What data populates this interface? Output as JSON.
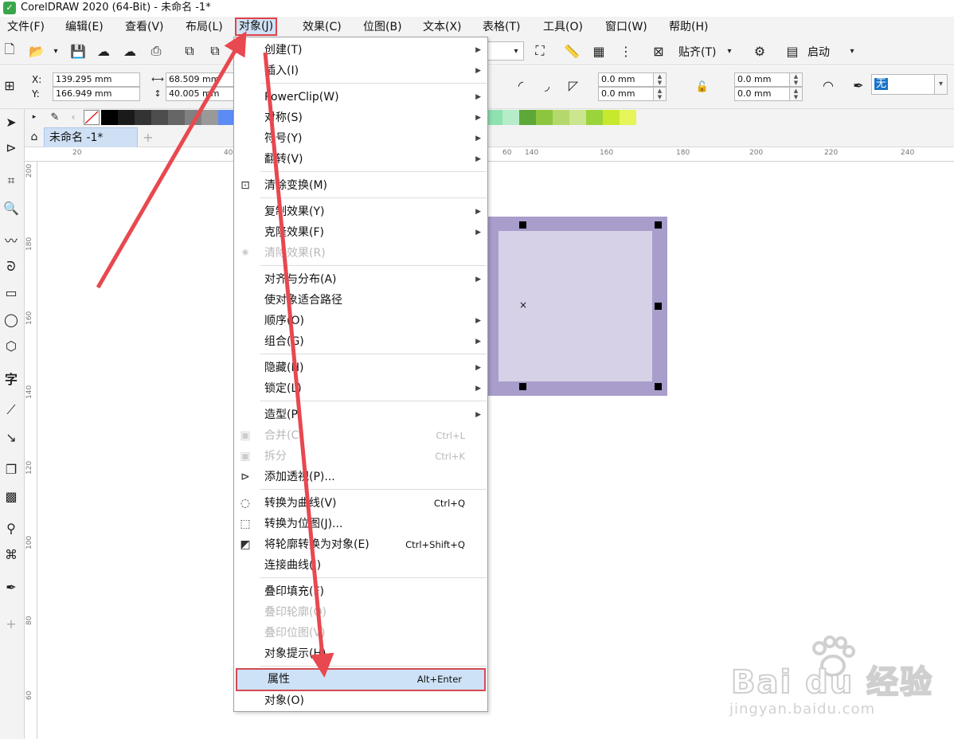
{
  "title": "CorelDRAW 2020 (64-Bit) - 未命名 -1*",
  "menubar": [
    "文件(F)",
    "编辑(E)",
    "查看(V)",
    "布局(L)",
    "对象(J)",
    "效果(C)",
    "位图(B)",
    "文本(X)",
    "表格(T)",
    "工具(O)",
    "窗口(W)",
    "帮助(H)"
  ],
  "toolbar": {
    "snap_label": "贴齐(T)",
    "launch_label": "启动"
  },
  "propbar": {
    "x_label": "X:",
    "x_value": "139.295 mm",
    "y_label": "Y:",
    "y_value": "166.949 mm",
    "w_value": "68.509 mm",
    "h_value": "40.005 mm",
    "corner1": "0.0 mm",
    "corner2": "0.0 mm",
    "corner3": "0.0 mm",
    "corner4": "0.0 mm",
    "outline_value": "无"
  },
  "doc_tab": "未命名 -1*",
  "ruler_h": [
    "20",
    "40",
    "60",
    "140",
    "160",
    "180",
    "200",
    "220",
    "240"
  ],
  "ruler_v": [
    "200",
    "180",
    "160",
    "140",
    "120",
    "100",
    "80",
    "60"
  ],
  "palette_colors": [
    "#000000",
    "#1a1a1a",
    "#333333",
    "#4d4d4d",
    "#666666",
    "#808080",
    "#999999",
    "#5b8cf5",
    "#5a6fe8",
    "#5a5ac8",
    "#1f3c8c",
    "#16206e",
    "#2a5aa8",
    "#00a6e8",
    "#6fd8f4",
    "#9acfcf",
    "#4f9595",
    "#2a5a5a",
    "#0e6a3c",
    "#1a8c50",
    "#29a85e",
    "#36b86b",
    "#56cc7e",
    "#8ee2b0",
    "#b7ecc9",
    "#5ea83a",
    "#8cc63f",
    "#b5d86d",
    "#cce58f",
    "#9ad43a",
    "#c8e830",
    "#e5f55a"
  ],
  "watermark": {
    "brand": "Bai du 经验",
    "url": "jingyan.baidu.com"
  },
  "menu": {
    "items": [
      {
        "label": "创建(T)",
        "shortcut": "",
        "arrow": true,
        "disabled": false
      },
      {
        "label": "插入(I)",
        "shortcut": "",
        "arrow": true,
        "disabled": false
      },
      {
        "label": "PowerClip(W)",
        "shortcut": "",
        "arrow": true,
        "disabled": false
      },
      {
        "label": "对称(S)",
        "shortcut": "",
        "arrow": true,
        "disabled": false
      },
      {
        "label": "符号(Y)",
        "shortcut": "",
        "arrow": true,
        "disabled": false
      },
      {
        "label": "翻转(V)",
        "shortcut": "",
        "arrow": true,
        "disabled": false
      },
      {
        "label": "清除变换(M)",
        "shortcut": "",
        "arrow": false,
        "disabled": false
      },
      {
        "label": "复制效果(Y)",
        "shortcut": "",
        "arrow": true,
        "disabled": false
      },
      {
        "label": "克隆效果(F)",
        "shortcut": "",
        "arrow": true,
        "disabled": false
      },
      {
        "label": "清除效果(R)",
        "shortcut": "",
        "arrow": false,
        "disabled": true
      },
      {
        "label": "对齐与分布(A)",
        "shortcut": "",
        "arrow": true,
        "disabled": false
      },
      {
        "label": "使对象适合路径",
        "shortcut": "",
        "arrow": false,
        "disabled": false
      },
      {
        "label": "顺序(O)",
        "shortcut": "",
        "arrow": true,
        "disabled": false
      },
      {
        "label": "组合(G)",
        "shortcut": "",
        "arrow": true,
        "disabled": false
      },
      {
        "label": "隐藏(H)",
        "shortcut": "",
        "arrow": true,
        "disabled": false
      },
      {
        "label": "锁定(L)",
        "shortcut": "",
        "arrow": true,
        "disabled": false
      },
      {
        "label": "造型(P)",
        "shortcut": "",
        "arrow": true,
        "disabled": false
      },
      {
        "label": "合并(C)",
        "shortcut": "Ctrl+L",
        "arrow": false,
        "disabled": true
      },
      {
        "label": "拆分",
        "shortcut": "Ctrl+K",
        "arrow": false,
        "disabled": true
      },
      {
        "label": "添加透视(P)...",
        "shortcut": "",
        "arrow": false,
        "disabled": false
      },
      {
        "label": "转换为曲线(V)",
        "shortcut": "Ctrl+Q",
        "arrow": false,
        "disabled": false
      },
      {
        "label": "转换为位图(J)...",
        "shortcut": "",
        "arrow": false,
        "disabled": false
      },
      {
        "label": "将轮廓转换为对象(E)",
        "shortcut": "Ctrl+Shift+Q",
        "arrow": false,
        "disabled": false
      },
      {
        "label": "连接曲线(J)",
        "shortcut": "",
        "arrow": false,
        "disabled": false
      },
      {
        "label": "叠印填充(F)",
        "shortcut": "",
        "arrow": false,
        "disabled": false
      },
      {
        "label": "叠印轮廓(O)",
        "shortcut": "",
        "arrow": false,
        "disabled": true
      },
      {
        "label": "叠印位图(V)",
        "shortcut": "",
        "arrow": false,
        "disabled": true
      },
      {
        "label": "对象提示(H)",
        "shortcut": "",
        "arrow": false,
        "disabled": false
      },
      {
        "label": "属性",
        "shortcut": "Alt+Enter",
        "arrow": false,
        "disabled": false
      },
      {
        "label": "对象(O)",
        "shortcut": "",
        "arrow": false,
        "disabled": false
      }
    ]
  },
  "colors": {
    "accent": "#e0434b",
    "highlight": "#cde2f6",
    "rect_outline": "#a99dcb",
    "rect_fill": "#d7d1e7"
  }
}
